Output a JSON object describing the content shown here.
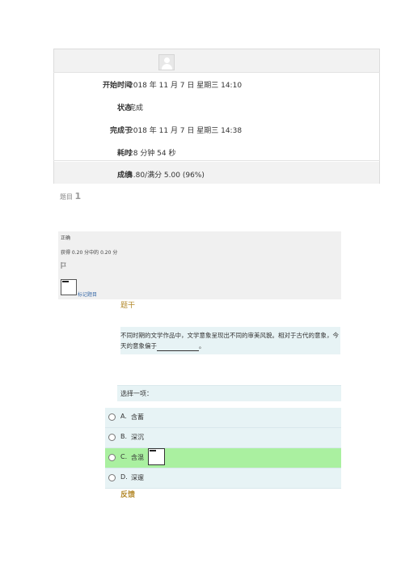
{
  "summary": {
    "rows": [
      {
        "label": "开始时间",
        "value": "2018 年 11 月 7 日  星期三  14:10"
      },
      {
        "label": "状态",
        "value": "完成"
      },
      {
        "label": "完成于",
        "value": "2018 年 11 月 7 日  星期三  14:38"
      },
      {
        "label": "耗时",
        "value": "28  分钟  54  秒"
      },
      {
        "label": "成绩",
        "value": "4.80/满分 5.00 (96%)"
      }
    ]
  },
  "question": {
    "number_prefix": "题目",
    "number": "1",
    "state": "正确",
    "grade": "获得 0.20 分中的 0.20 分",
    "flag_label": "标记题目",
    "text_heading": "题干",
    "text_part1": "不同时期的文学作品中，文学意象呈现出不同的审美风貌。相对于古代的意象，今天的意象偏于",
    "text_part2": "。",
    "prompt": "选择一项：",
    "options": [
      {
        "letter": "A.",
        "text": "含蓄"
      },
      {
        "letter": "B.",
        "text": "深沉"
      },
      {
        "letter": "C.",
        "text": "含混"
      },
      {
        "letter": "D.",
        "text": "深邃"
      }
    ],
    "feedback_heading": "反馈"
  }
}
